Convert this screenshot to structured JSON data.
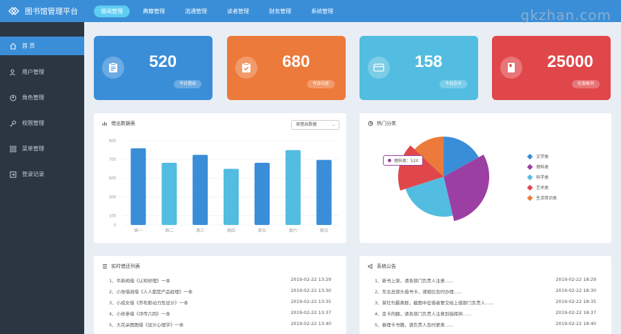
{
  "header": {
    "title": "图书馆管理平台",
    "nav": [
      "借阅管理",
      "典籍管理",
      "流通管理",
      "读者管理",
      "财务管理",
      "系统管理"
    ],
    "active_nav": 0
  },
  "watermark": "gkzhan.com",
  "sidebar": {
    "items": [
      {
        "label": "首    页",
        "icon": "home-icon",
        "active": true
      },
      {
        "label": "用户管理",
        "icon": "user-icon"
      },
      {
        "label": "角色管理",
        "icon": "role-icon"
      },
      {
        "label": "权限管理",
        "icon": "key-icon"
      },
      {
        "label": "菜单管理",
        "icon": "menu-grid-icon"
      },
      {
        "label": "登录记录",
        "icon": "login-log-icon"
      }
    ]
  },
  "stats": [
    {
      "value": "520",
      "label": "今日借出",
      "color": "#3a8ed8",
      "icon": "clipboard-icon"
    },
    {
      "value": "680",
      "label": "今日归还",
      "color": "#ec7a3a",
      "icon": "clipboard-check-icon"
    },
    {
      "value": "158",
      "label": "今日办卡",
      "color": "#52bde0",
      "icon": "card-icon"
    },
    {
      "value": "25000",
      "label": "在架图书",
      "color": "#e0474a",
      "icon": "book-icon"
    }
  ],
  "borrow_panel": {
    "title": "借出数据表",
    "select_value": "周借出数据"
  },
  "hot_panel": {
    "title": "热门分类",
    "tooltip": "理科类：520"
  },
  "realtime_panel": {
    "title": "实时借还列表",
    "rows": [
      {
        "text": "1、平新闻借《认知修理》一本",
        "time": "2019-02-22  13:29"
      },
      {
        "text": "2、小张借阅借《人人都是产品经理》一本",
        "time": "2019-02-22  13:30"
      },
      {
        "text": "3、小成女借《乔布斯动力性设计》一本",
        "time": "2019-02-22  13:35"
      },
      {
        "text": "4、小修参借《评传六四》一本",
        "time": "2019-02-22  13:37"
      },
      {
        "text": "5、大花朵图图借《设计心理学》一本",
        "time": "2019-02-22  13:40"
      }
    ]
  },
  "notice_panel": {
    "title": "系统公告",
    "rows": [
      {
        "text": "1、新书上架，请各部门负责人注意......",
        "time": "2019-02-22  18:29"
      },
      {
        "text": "2、东北总部头借书卡，请相位及时办理......",
        "time": "2019-02-22  18:30"
      },
      {
        "text": "3、某社刊最离群，截图中征借者要交给上借部门负责人......",
        "time": "2019-02-22  18:35"
      },
      {
        "text": "4、变卡的翻，请各部门负责人注意到指挥供......",
        "time": "2019-02-22  18:37"
      },
      {
        "text": "5、春理卡书籍，请负责人及时更来......",
        "time": "2019-02-22  18:40"
      }
    ]
  },
  "chart_data": [
    {
      "type": "bar",
      "title": "借出数据表",
      "categories": [
        "周一",
        "周二",
        "周三",
        "周四",
        "周五",
        "周六",
        "周日"
      ],
      "values": [
        820,
        665,
        750,
        600,
        665,
        800,
        695
      ],
      "ylim": [
        0,
        900
      ],
      "yticks": [
        0,
        100,
        300,
        500,
        700,
        900
      ],
      "color": "#3a8ed8",
      "alt_color": "#52bde0",
      "grid": true
    },
    {
      "type": "pie",
      "title": "热门分类",
      "legend_position": "right",
      "slices": [
        {
          "name": "文学类",
          "value": 300,
          "color": "#3a8ed8"
        },
        {
          "name": "理科类",
          "value": 520,
          "color": "#9c3fa3"
        },
        {
          "name": "科学类",
          "value": 420,
          "color": "#52bde0"
        },
        {
          "name": "艺术类",
          "value": 300,
          "color": "#e0474a"
        },
        {
          "name": "生活常识类",
          "value": 230,
          "color": "#ec7a3a"
        }
      ]
    }
  ]
}
